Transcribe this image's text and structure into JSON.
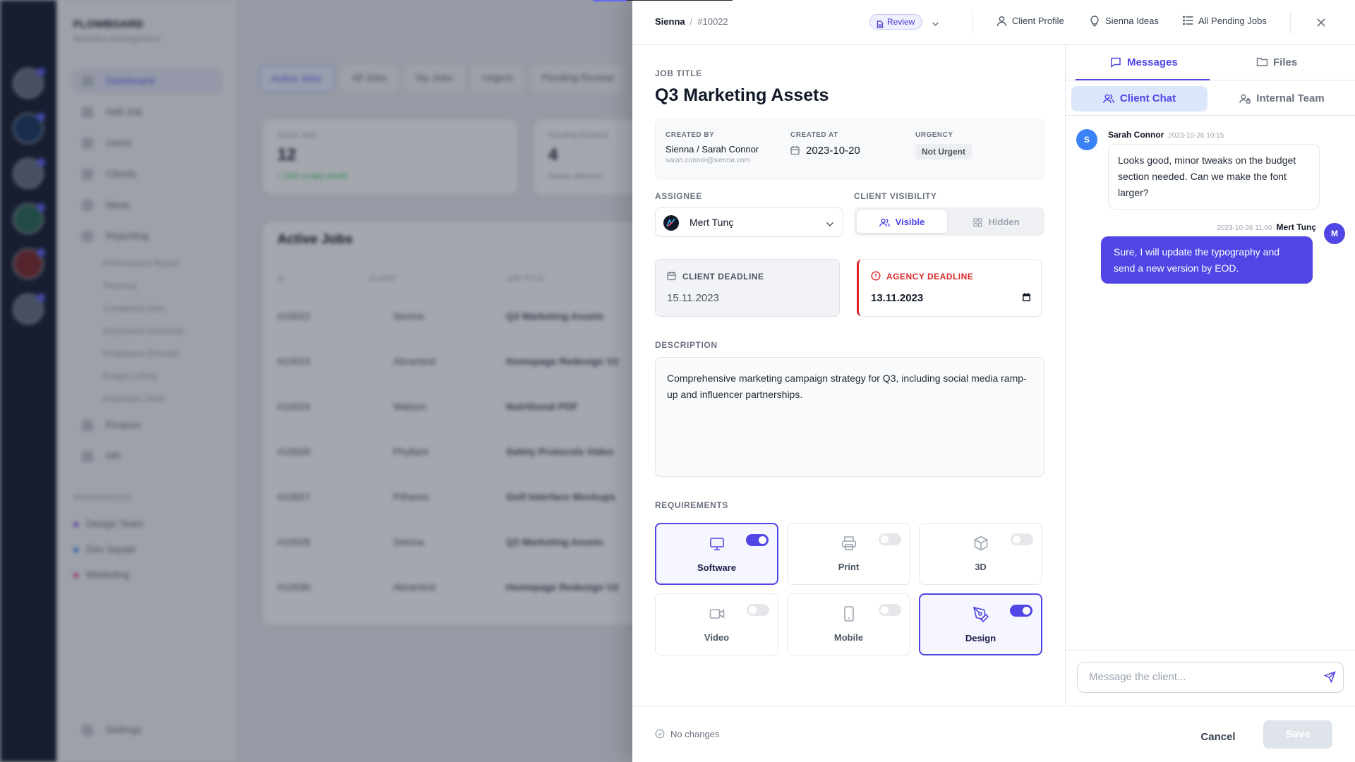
{
  "background_app": {
    "brand": "FLOWBOARD",
    "brand_sub": "Workflow Management",
    "nav": [
      "Dashboard",
      "Add Job",
      "Users",
      "Clients",
      "Ideas",
      "Reporting",
      "Finance",
      "HR"
    ],
    "reporting_sub": [
      "Performance Report",
      "Planning",
      "Completed Jobs",
      "Employees (General)",
      "Employees (Private)",
      "Budget Listing",
      "Employee Client"
    ],
    "workspaces_label": "WORKSPACES",
    "workspaces": [
      {
        "name": "Design Team",
        "color": "#8b5cf6"
      },
      {
        "name": "Dev Squad",
        "color": "#3b82f6"
      },
      {
        "name": "Marketing",
        "color": "#ec4899"
      }
    ],
    "settings": "Settings",
    "tabs": [
      "Active Jobs",
      "All Jobs",
      "My Jobs",
      "Urgent",
      "Pending Review"
    ],
    "stats": [
      {
        "label": "Active Jobs",
        "value": "12",
        "note": "+ 16% vs last month"
      },
      {
        "label": "Pending Reviews",
        "value": "4",
        "note": "Needs attention"
      }
    ],
    "table_title": "Active Jobs",
    "table_headers": [
      "ID",
      "CLIENT",
      "JOB TITLE"
    ],
    "rows": [
      {
        "id": "#10022",
        "client": "Sienna",
        "title": "Q3 Marketing Assets"
      },
      {
        "id": "#10023",
        "client": "Abramind",
        "title": "Homepage Redesign V2"
      },
      {
        "id": "#10024",
        "client": "Watson",
        "title": "Nutritional PDF"
      },
      {
        "id": "#10026",
        "client": "Phyllant",
        "title": "Safety Protocols Video"
      },
      {
        "id": "#10027",
        "client": "Pithemo",
        "title": "Golf Interface Mockups"
      },
      {
        "id": "#10028",
        "client": "Sienna",
        "title": "Q3 Marketing Assets"
      },
      {
        "id": "#10030",
        "client": "Abramind",
        "title": "Homepage Redesign V2"
      }
    ]
  },
  "drawer": {
    "breadcrumb": {
      "client": "Sienna",
      "separator": "/",
      "job_id": "#10022"
    },
    "status": "Review",
    "header_links": {
      "client_profile": "Client Profile",
      "ideas": "Sienna Ideas",
      "pending": "All Pending Jobs"
    },
    "job_title_label": "JOB TITLE",
    "job_title": "Q3 Marketing Assets",
    "meta": {
      "created_by_label": "CREATED BY",
      "created_by": "Sienna / Sarah Connor",
      "created_by_email": "sarah.connor@sienna.com",
      "created_at_label": "CREATED AT",
      "created_at": "2023-10-20",
      "urgency_label": "URGENCY",
      "urgency": "Not Urgent"
    },
    "assignee_label": "ASSIGNEE",
    "assignee": "Mert Tunç",
    "visibility_label": "CLIENT VISIBILITY",
    "visibility_options": {
      "visible": "Visible",
      "hidden": "Hidden"
    },
    "client_deadline_label": "CLIENT DEADLINE",
    "client_deadline": "15.11.2023",
    "agency_deadline_label": "AGENCY DEADLINE",
    "agency_deadline": "13.11.2023",
    "description_label": "DESCRIPTION",
    "description": "Comprehensive marketing campaign strategy for Q3, including social media ramp-up and influencer partnerships.",
    "requirements_label": "REQUIREMENTS",
    "requirements": [
      {
        "label": "Software",
        "enabled": true,
        "icon": "monitor-icon"
      },
      {
        "label": "Print",
        "enabled": false,
        "icon": "printer-icon"
      },
      {
        "label": "3D",
        "enabled": false,
        "icon": "cube-icon"
      },
      {
        "label": "Video",
        "enabled": false,
        "icon": "video-icon"
      },
      {
        "label": "Mobile",
        "enabled": false,
        "icon": "mobile-icon"
      },
      {
        "label": "Design",
        "enabled": true,
        "icon": "pen-tool-icon"
      }
    ],
    "footer": {
      "status": "No changes",
      "cancel": "Cancel",
      "save": "Save"
    }
  },
  "chat": {
    "tabs": {
      "messages": "Messages",
      "files": "Files"
    },
    "subtabs": {
      "client": "Client Chat",
      "internal": "Internal Team"
    },
    "messages": [
      {
        "author": "Sarah Connor",
        "initial": "S",
        "time": "2023-10-26 10:15",
        "text": "Looks good, minor tweaks on the budget section needed. Can we make the font larger?"
      },
      {
        "author": "Mert Tunç",
        "initial": "M",
        "time": "2023-10-26 11:00",
        "text": "Sure, I will update the typography and send a new version by EOD."
      }
    ],
    "composer_placeholder": "Message the client..."
  },
  "colors": {
    "accent": "#4f46e5",
    "danger": "#dc2626",
    "client_avatar": "#3b82f6"
  }
}
